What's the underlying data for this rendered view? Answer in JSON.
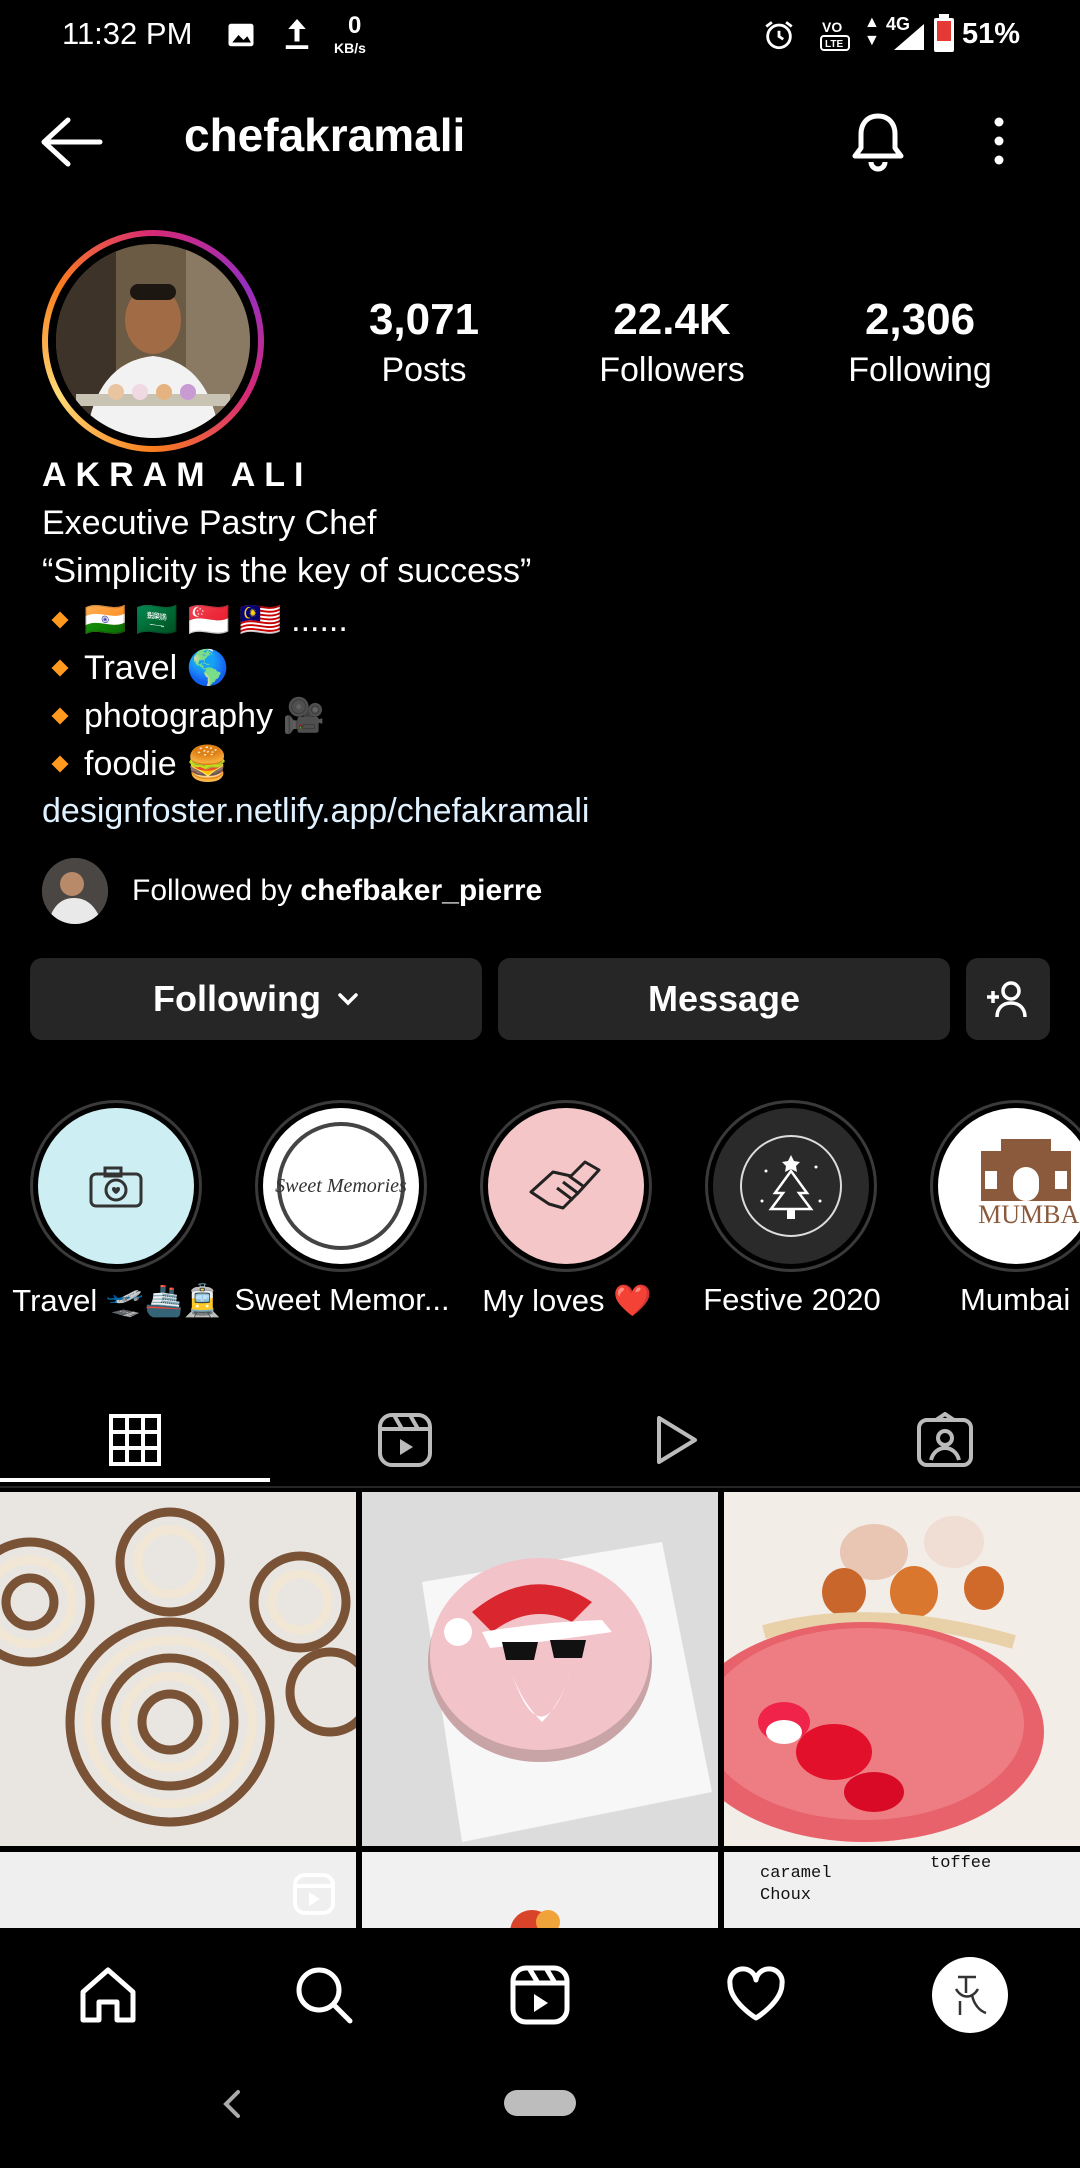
{
  "status_bar": {
    "time": "11:32 PM",
    "kbs_value": "0",
    "kbs_unit": "KB/s",
    "network": "4G",
    "battery": "51%"
  },
  "header": {
    "username": "chefakramali"
  },
  "profile": {
    "stats": [
      {
        "value": "3,071",
        "label": "Posts"
      },
      {
        "value": "22.4K",
        "label": "Followers"
      },
      {
        "value": "2,306",
        "label": "Following"
      }
    ],
    "display_name": "AKRAM ALI",
    "bio": {
      "line1": "Executive Pastry Chef",
      "line2": "“Simplicity is the key of success”",
      "flags": "🇮🇳 🇸🇦 🇸🇬 🇲🇾 ......",
      "item1": "Travel 🌎",
      "item2": "photography 🎥",
      "item3": "foodie 🍔",
      "link": "designfoster.netlify.app/chefakramali"
    },
    "followed_by_prefix": "Followed by ",
    "followed_by_user": "chefbaker_pierre"
  },
  "actions": {
    "following": "Following",
    "message": "Message"
  },
  "highlights": [
    {
      "label": "Travel 🛫🚢🚊",
      "bg": "#cdeff3"
    },
    {
      "label": "Sweet Memor...",
      "bg": "#ffffff",
      "art": "Sweet Memories"
    },
    {
      "label": "My loves ❤️",
      "bg": "#f4c6c8"
    },
    {
      "label": "Festive 2020",
      "bg": "#2a2a2a"
    },
    {
      "label": "Mumbai",
      "bg": "#ffffff",
      "art": "MUMBAI"
    }
  ],
  "grid_text": {
    "cell6_a": "caramel",
    "cell6_b": "Choux",
    "cell6_c": "toffee"
  },
  "colors": {
    "accent_bullet": "#ff9a1f",
    "button_bg": "#262626",
    "link": "#e0f1ff"
  }
}
